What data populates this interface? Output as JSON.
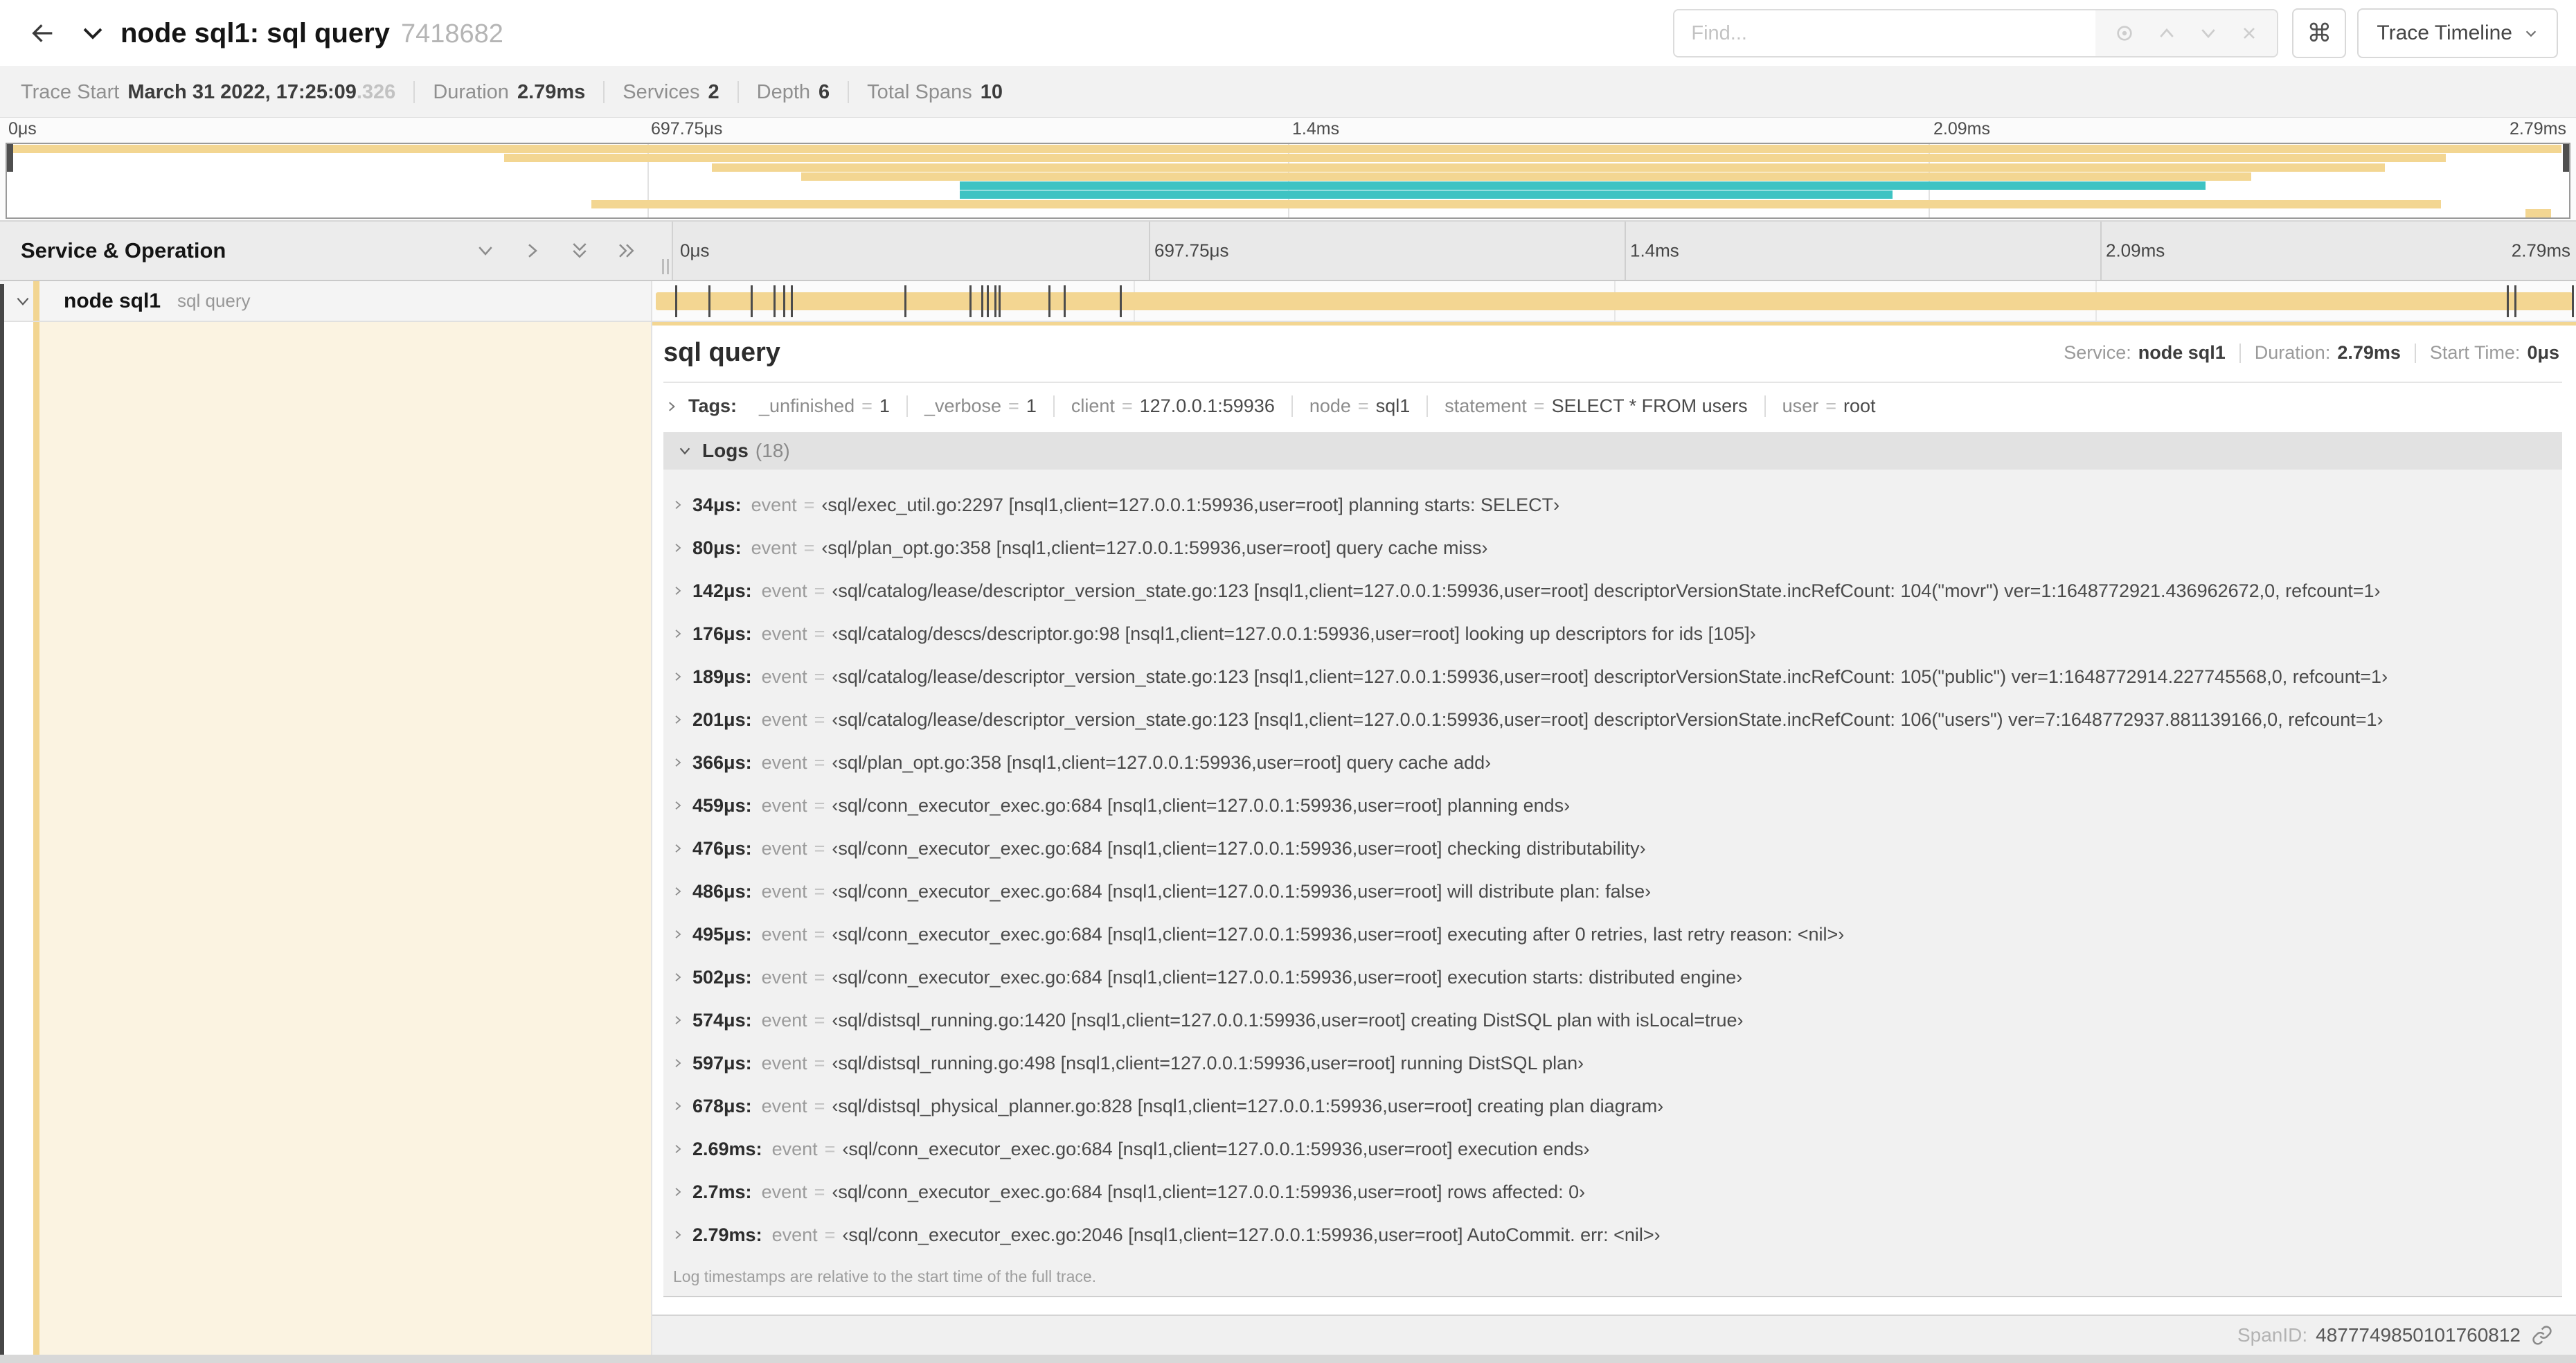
{
  "colors": {
    "span_tan": "#f3d692",
    "span_teal": "#3ec3c3",
    "selected_row_cream": "#fbf3e1",
    "accent_stripe": "#f2d591"
  },
  "header": {
    "title": "node sql1: sql query",
    "trace_id": "7418682",
    "find_placeholder": "Find...",
    "shortcut_glyph": "⌘",
    "view_button_label": "Trace Timeline"
  },
  "trace_meta": {
    "items": [
      {
        "label": "Trace Start",
        "value": "March 31 2022, 17:25:09",
        "muted": ".326"
      },
      {
        "label": "Duration",
        "value": "2.79ms"
      },
      {
        "label": "Services",
        "value": "2"
      },
      {
        "label": "Depth",
        "value": "6"
      },
      {
        "label": "Total Spans",
        "value": "10"
      }
    ]
  },
  "timeline": {
    "ticks": [
      {
        "label": "0μs",
        "pos": 0
      },
      {
        "label": "697.75μs",
        "pos": 25
      },
      {
        "label": "1.4ms",
        "pos": 50
      },
      {
        "label": "2.09ms",
        "pos": 75
      },
      {
        "label": "2.79ms",
        "pos": 100
      }
    ],
    "gridlines": [
      25,
      50,
      75
    ],
    "log_marks": [
      1.2,
      2.9,
      5.1,
      6.3,
      6.8,
      7.2,
      13.1,
      16.5,
      17.1,
      17.4,
      17.8,
      18.0,
      20.6,
      21.4,
      24.3,
      96.4,
      96.8,
      99.8
    ],
    "minimap": {
      "rows": 8,
      "bars": [
        {
          "r": 0,
          "s": 0,
          "e": 99.7,
          "c": "tan"
        },
        {
          "r": 1,
          "s": 19.4,
          "e": 95.2,
          "c": "tan"
        },
        {
          "r": 2,
          "s": 27.5,
          "e": 92.8,
          "c": "tan"
        },
        {
          "r": 3,
          "s": 31,
          "e": 87.6,
          "c": "tan"
        },
        {
          "r": 4,
          "s": 37.2,
          "e": 85.8,
          "c": "teal"
        },
        {
          "r": 5,
          "s": 37.2,
          "e": 73.6,
          "c": "teal"
        },
        {
          "r": 6,
          "s": 22.8,
          "e": 95,
          "c": "tan"
        },
        {
          "r": 7,
          "s": 98.3,
          "e": 99.3,
          "c": "tan"
        }
      ]
    }
  },
  "span_list": {
    "header": "Service & Operation",
    "row": {
      "service": "node sql1",
      "operation": "sql query"
    }
  },
  "detail": {
    "title": "sql query",
    "meta": [
      {
        "label": "Service:",
        "value": "node sql1"
      },
      {
        "label": "Duration:",
        "value": "2.79ms"
      },
      {
        "label": "Start Time:",
        "value": "0μs"
      }
    ],
    "tags_label": "Tags:",
    "tag_eq": "=",
    "tags": [
      {
        "key": "_unfinished",
        "value": "1"
      },
      {
        "key": "_verbose",
        "value": "1"
      },
      {
        "key": "client",
        "value": "127.0.0.1:59936"
      },
      {
        "key": "node",
        "value": "sql1"
      },
      {
        "key": "statement",
        "value": "SELECT * FROM users"
      },
      {
        "key": "user",
        "value": "root"
      }
    ],
    "logs_label": "Logs",
    "logs_count": "(18)",
    "log_item_key": "event",
    "log_item_eq": "=",
    "logs": [
      {
        "t": "34μs:",
        "msg": "‹sql/exec_util.go:2297 [nsql1,client=127.0.0.1:59936,user=root] planning starts: SELECT›"
      },
      {
        "t": "80μs:",
        "msg": "‹sql/plan_opt.go:358 [nsql1,client=127.0.0.1:59936,user=root] query cache miss›"
      },
      {
        "t": "142μs:",
        "msg": "‹sql/catalog/lease/descriptor_version_state.go:123 [nsql1,client=127.0.0.1:59936,user=root] descriptorVersionState.incRefCount: 104(\"movr\") ver=1:1648772921.436962672,0, refcount=1›"
      },
      {
        "t": "176μs:",
        "msg": "‹sql/catalog/descs/descriptor.go:98 [nsql1,client=127.0.0.1:59936,user=root] looking up descriptors for ids [105]›"
      },
      {
        "t": "189μs:",
        "msg": "‹sql/catalog/lease/descriptor_version_state.go:123 [nsql1,client=127.0.0.1:59936,user=root] descriptorVersionState.incRefCount: 105(\"public\") ver=1:1648772914.227745568,0, refcount=1›"
      },
      {
        "t": "201μs:",
        "msg": "‹sql/catalog/lease/descriptor_version_state.go:123 [nsql1,client=127.0.0.1:59936,user=root] descriptorVersionState.incRefCount: 106(\"users\") ver=7:1648772937.881139166,0, refcount=1›"
      },
      {
        "t": "366μs:",
        "msg": "‹sql/plan_opt.go:358 [nsql1,client=127.0.0.1:59936,user=root] query cache add›"
      },
      {
        "t": "459μs:",
        "msg": "‹sql/conn_executor_exec.go:684 [nsql1,client=127.0.0.1:59936,user=root] planning ends›"
      },
      {
        "t": "476μs:",
        "msg": "‹sql/conn_executor_exec.go:684 [nsql1,client=127.0.0.1:59936,user=root] checking distributability›"
      },
      {
        "t": "486μs:",
        "msg": "‹sql/conn_executor_exec.go:684 [nsql1,client=127.0.0.1:59936,user=root] will distribute plan: false›"
      },
      {
        "t": "495μs:",
        "msg": "‹sql/conn_executor_exec.go:684 [nsql1,client=127.0.0.1:59936,user=root] executing after 0 retries, last retry reason: <nil>›"
      },
      {
        "t": "502μs:",
        "msg": "‹sql/conn_executor_exec.go:684 [nsql1,client=127.0.0.1:59936,user=root] execution starts: distributed engine›"
      },
      {
        "t": "574μs:",
        "msg": "‹sql/distsql_running.go:1420 [nsql1,client=127.0.0.1:59936,user=root] creating DistSQL plan with isLocal=true›"
      },
      {
        "t": "597μs:",
        "msg": "‹sql/distsql_running.go:498 [nsql1,client=127.0.0.1:59936,user=root] running DistSQL plan›"
      },
      {
        "t": "678μs:",
        "msg": "‹sql/distsql_physical_planner.go:828 [nsql1,client=127.0.0.1:59936,user=root] creating plan diagram›"
      },
      {
        "t": "2.69ms:",
        "msg": "‹sql/conn_executor_exec.go:684 [nsql1,client=127.0.0.1:59936,user=root] execution ends›"
      },
      {
        "t": "2.7ms:",
        "msg": "‹sql/conn_executor_exec.go:684 [nsql1,client=127.0.0.1:59936,user=root] rows affected: 0›"
      },
      {
        "t": "2.79ms:",
        "msg": "‹sql/conn_executor_exec.go:2046 [nsql1,client=127.0.0.1:59936,user=root] AutoCommit. err: <nil>›"
      }
    ],
    "footer_note": "Log timestamps are relative to the start time of the full trace.",
    "spanid_label": "SpanID:",
    "spanid": "4877749850101760812"
  }
}
